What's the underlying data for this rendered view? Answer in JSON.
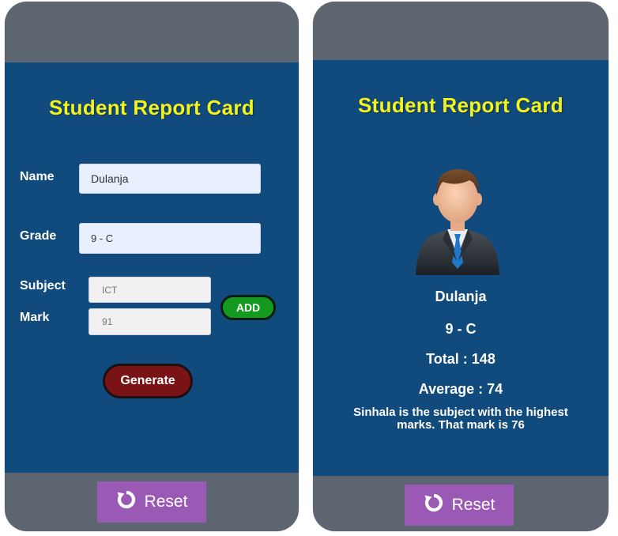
{
  "left_screen": {
    "title": "Student Report Card",
    "name_label": "Name",
    "name_value": "Dulanja",
    "grade_label": "Grade",
    "grade_value": "9 - C",
    "subject_label": "Subject",
    "subject_placeholder": "ICT",
    "mark_label": "Mark",
    "mark_placeholder": "91",
    "add_label": "ADD",
    "generate_label": "Generate",
    "reset_label": "Reset",
    "reset_icon": "refresh-icon"
  },
  "right_screen": {
    "title": "Student Report Card",
    "avatar_icon": "student-avatar",
    "student_name": "Dulanja",
    "grade": "9 - C",
    "total": "Total : 148",
    "average": "Average : 74",
    "highest_message": "Sinhala is the subject with the highest marks. That mark is 76",
    "reset_label": "Reset",
    "reset_icon": "refresh-icon"
  },
  "colors": {
    "screen_bg": "#114a7c",
    "frame": "#5d6670",
    "title": "#f4f41c",
    "add_button": "#149a1e",
    "generate_button": "#7a1315",
    "reset_button": "#9b59b6"
  }
}
